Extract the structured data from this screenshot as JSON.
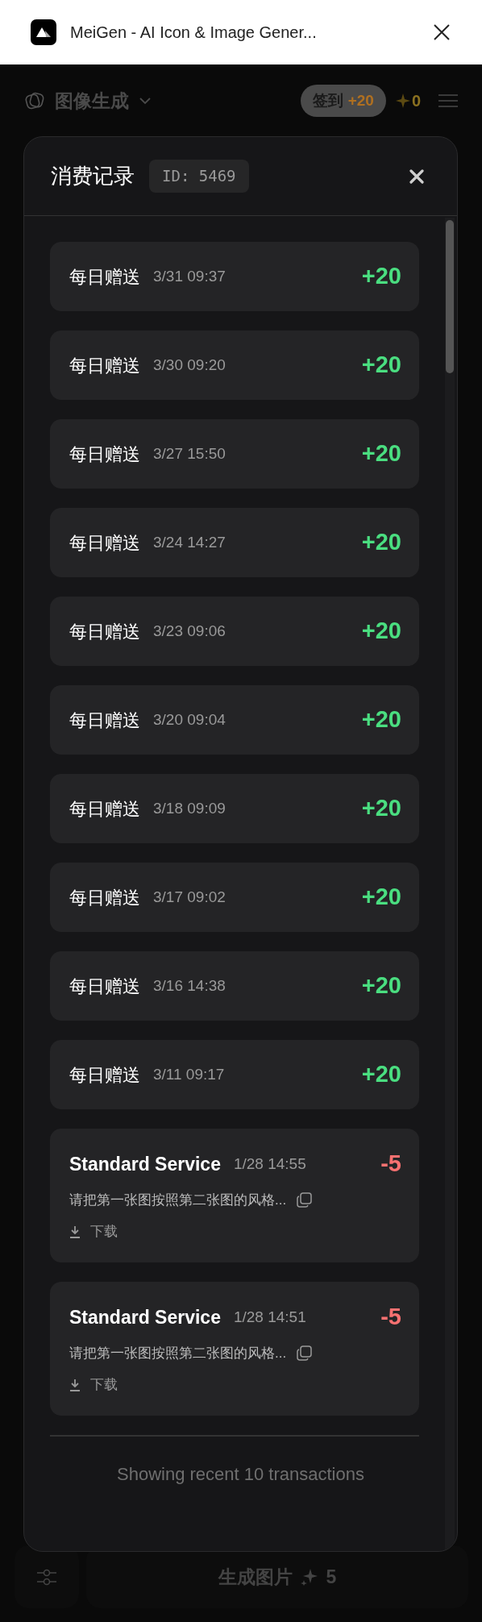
{
  "window": {
    "title": "MeiGen - AI Icon & Image Gener..."
  },
  "app_bar": {
    "mode": "图像生成",
    "checkin_label": "签到",
    "checkin_bonus": "+20",
    "credits": "0"
  },
  "modal": {
    "title": "消费记录",
    "user_id": "ID: 5469",
    "transactions": [
      {
        "kind": "gift",
        "name": "每日赠送",
        "time": "3/31 09:37",
        "amount": "+20"
      },
      {
        "kind": "gift",
        "name": "每日赠送",
        "time": "3/30 09:20",
        "amount": "+20"
      },
      {
        "kind": "gift",
        "name": "每日赠送",
        "time": "3/27 15:50",
        "amount": "+20"
      },
      {
        "kind": "gift",
        "name": "每日赠送",
        "time": "3/24 14:27",
        "amount": "+20"
      },
      {
        "kind": "gift",
        "name": "每日赠送",
        "time": "3/23 09:06",
        "amount": "+20"
      },
      {
        "kind": "gift",
        "name": "每日赠送",
        "time": "3/20 09:04",
        "amount": "+20"
      },
      {
        "kind": "gift",
        "name": "每日赠送",
        "time": "3/18 09:09",
        "amount": "+20"
      },
      {
        "kind": "gift",
        "name": "每日赠送",
        "time": "3/17 09:02",
        "amount": "+20"
      },
      {
        "kind": "gift",
        "name": "每日赠送",
        "time": "3/16 14:38",
        "amount": "+20"
      },
      {
        "kind": "gift",
        "name": "每日赠送",
        "time": "3/11 09:17",
        "amount": "+20"
      },
      {
        "kind": "service",
        "name": "Standard Service",
        "time": "1/28 14:55",
        "amount": "-5",
        "prompt": "请把第一张图按照第二张图的风格...",
        "download": "下载"
      },
      {
        "kind": "service",
        "name": "Standard Service",
        "time": "1/28 14:51",
        "amount": "-5",
        "prompt": "请把第一张图按照第二张图的风格...",
        "download": "下载"
      }
    ],
    "footer": "Showing recent 10 transactions"
  },
  "bottom_bar": {
    "generate": "生成图片",
    "cost": "5"
  }
}
